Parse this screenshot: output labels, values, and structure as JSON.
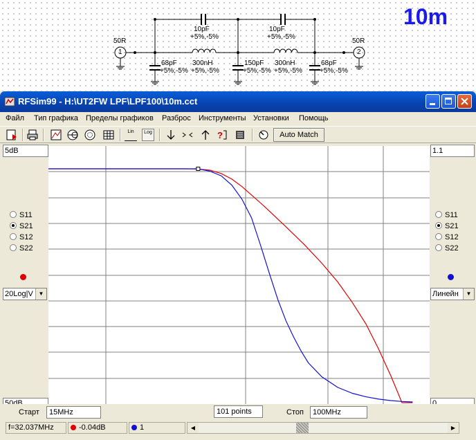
{
  "schematic": {
    "band_label": "10m",
    "port1": {
      "impedance": "50R",
      "number": "1"
    },
    "port2": {
      "impedance": "50R",
      "number": "2"
    },
    "components": [
      {
        "value": "10pF",
        "tolerance": "+5%,-5%"
      },
      {
        "value": "10pF",
        "tolerance": "+5%,-5%"
      },
      {
        "value": "300nH",
        "tolerance": "+5%,-5%"
      },
      {
        "value": "300nH",
        "tolerance": "+5%,-5%"
      },
      {
        "value": "68pF",
        "tolerance": "+5%,-5%"
      },
      {
        "value": "150pF",
        "tolerance": "+5%,-5%"
      },
      {
        "value": "68pF",
        "tolerance": "+5%,-5%"
      }
    ]
  },
  "window": {
    "title": "RFSim99 - H:\\UT2FW LPF\\LPF100\\10m.cct",
    "menu": [
      "Файл",
      "Тип графика",
      "Пределы графиков",
      "Разброс",
      "Инструменты",
      "Установки",
      "Помощь"
    ],
    "toolbar": {
      "icons": [
        "save-icon",
        "print-icon",
        "graph-icon",
        "smith-chart-icon",
        "polar-chart-icon",
        "table-icon",
        "lin-scale-icon",
        "log-scale-icon",
        "marker-down-icon",
        "marker-center-icon",
        "marker-up-icon",
        "help-icon",
        "component-icon",
        "tune-icon"
      ],
      "lin_label": "Lin",
      "log_label": "Log",
      "auto_match_label": "Auto Match"
    }
  },
  "left_panel": {
    "scale_top": "5dB",
    "scale_bottom": "50dB",
    "radio_options": [
      "S11",
      "S21",
      "S12",
      "S22"
    ],
    "selected": "S21",
    "trace_color": "#e00000",
    "format": "20Log|V"
  },
  "right_panel": {
    "scale_top": "1.1",
    "scale_bottom": "0",
    "radio_options": [
      "S11",
      "S21",
      "S12",
      "S22"
    ],
    "selected": "S21",
    "trace_color": "#1010d0",
    "format": "Линейн"
  },
  "sweep": {
    "start_label": "Старт",
    "start_value": "15MHz",
    "points": "101 points",
    "stop_label": "Стоп",
    "stop_value": "100MHz"
  },
  "status": {
    "frequency": "f=32.037MHz",
    "red_readout": "-0.04dB",
    "blue_readout": "1"
  },
  "chart_data": {
    "type": "line",
    "xlim": [
      15,
      100
    ],
    "x_unit": "MHz",
    "grid": true,
    "grid_vertical_count": 4,
    "grid_horizontal_count": 9,
    "series": [
      {
        "color": "#e00000",
        "axis": "left",
        "scale": "dB",
        "ylim": [
          -50,
          5
        ],
        "x": [
          15,
          20,
          25,
          30,
          32,
          34,
          36,
          38,
          40,
          42,
          45,
          50,
          55,
          60,
          65,
          70,
          75,
          80,
          85,
          90,
          95
        ],
        "y": [
          0,
          0,
          0,
          0,
          -0.04,
          -0.3,
          -1,
          -2.2,
          -3.8,
          -5.6,
          -8.2,
          -12.4,
          -16.3,
          -20.2,
          -24.2,
          -28.6,
          -33.2,
          -38.6,
          -44.2,
          -50,
          -50
        ]
      },
      {
        "color": "#1010d0",
        "axis": "right",
        "scale": "linear",
        "ylim": [
          0,
          1.1
        ],
        "x": [
          15,
          20,
          25,
          30,
          32,
          34,
          36,
          38,
          40,
          42,
          44,
          46,
          48,
          50,
          52,
          54,
          56,
          60,
          65,
          70,
          75,
          80,
          85,
          90,
          95
        ],
        "y": [
          1,
          1,
          1,
          1,
          1,
          0.99,
          0.97,
          0.93,
          0.87,
          0.79,
          0.67,
          0.55,
          0.44,
          0.35,
          0.28,
          0.22,
          0.17,
          0.11,
          0.065,
          0.04,
          0.025,
          0.015,
          0.009,
          0.005,
          0.003
        ]
      }
    ]
  }
}
